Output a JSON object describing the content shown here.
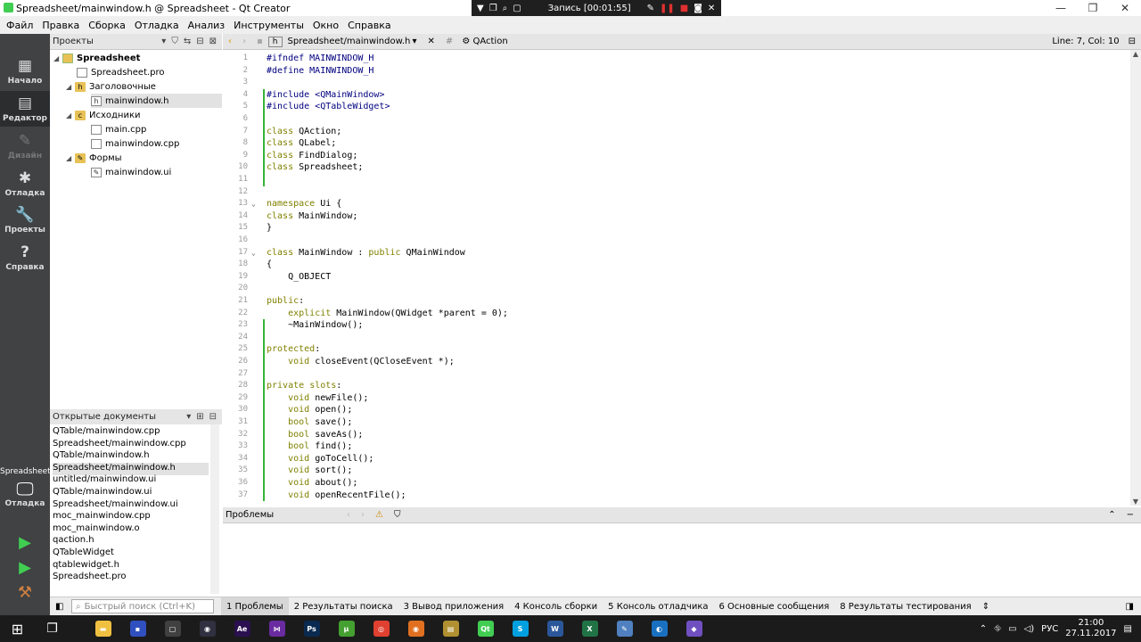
{
  "window": {
    "title": "Spreadsheet/mainwindow.h @ Spreadsheet - Qt Creator",
    "controls": [
      "—",
      "❐",
      "✕"
    ]
  },
  "recording": {
    "label": "Запись [00:01:55]"
  },
  "menu": [
    "Файл",
    "Правка",
    "Сборка",
    "Отладка",
    "Анализ",
    "Инструменты",
    "Окно",
    "Справка"
  ],
  "modes": [
    {
      "label": "Начало",
      "icon": "▦"
    },
    {
      "label": "Редактор",
      "icon": "▤"
    },
    {
      "label": "Дизайн",
      "icon": "✎"
    },
    {
      "label": "Отладка",
      "icon": "✱"
    },
    {
      "label": "Проекты",
      "icon": "🔧"
    },
    {
      "label": "Справка",
      "icon": "?"
    }
  ],
  "kit": {
    "project": "Spreadsheet",
    "config": "Отладка"
  },
  "projects": {
    "header": "Проекты",
    "tree": [
      {
        "label": "Spreadsheet",
        "level": 0,
        "kind": "proj",
        "arrow": "◢",
        "bold": true
      },
      {
        "label": "Spreadsheet.pro",
        "level": 1,
        "kind": "file",
        "arrow": ""
      },
      {
        "label": "Заголовочные",
        "level": 1,
        "kind": "folder",
        "arrow": "◢"
      },
      {
        "label": "mainwindow.h",
        "level": 2,
        "kind": "file",
        "arrow": "",
        "selected": true
      },
      {
        "label": "Исходники",
        "level": 1,
        "kind": "folder",
        "arrow": "◢"
      },
      {
        "label": "main.cpp",
        "level": 2,
        "kind": "file",
        "arrow": ""
      },
      {
        "label": "mainwindow.cpp",
        "level": 2,
        "kind": "file",
        "arrow": ""
      },
      {
        "label": "Формы",
        "level": 1,
        "kind": "folder",
        "arrow": "◢"
      },
      {
        "label": "mainwindow.ui",
        "level": 2,
        "kind": "file",
        "arrow": ""
      }
    ]
  },
  "open_documents": {
    "header": "Открытые документы",
    "items": [
      "QTable/mainwindow.cpp",
      "Spreadsheet/mainwindow.cpp",
      "QTable/mainwindow.h",
      "Spreadsheet/mainwindow.h",
      "untitled/mainwindow.ui",
      "QTable/mainwindow.ui",
      "Spreadsheet/mainwindow.ui",
      "moc_mainwindow.cpp",
      "moc_mainwindow.o",
      "qaction.h",
      "QTableWidget",
      "qtablewidget.h",
      "Spreadsheet.pro"
    ],
    "selected_index": 3
  },
  "editor": {
    "file_tab": "Spreadsheet/mainwindow.h",
    "symbol": "QAction",
    "cursor": "Line: 7, Col: 10",
    "lines": [
      {
        "n": "1",
        "t": "#ifndef MAINWINDOW_H"
      },
      {
        "n": "2",
        "t": "#define MAINWINDOW_H"
      },
      {
        "n": "3",
        "t": ""
      },
      {
        "n": "4",
        "t": "#include <QMainWindow>"
      },
      {
        "n": "5",
        "t": "#include <QTableWidget>"
      },
      {
        "n": "6",
        "t": ""
      },
      {
        "n": "7",
        "t": "class QAction;"
      },
      {
        "n": "8",
        "t": "class QLabel;"
      },
      {
        "n": "9",
        "t": "class FindDialog;"
      },
      {
        "n": "10",
        "t": "class Spreadsheet;"
      },
      {
        "n": "11",
        "t": ""
      },
      {
        "n": "12",
        "t": ""
      },
      {
        "n": "13",
        "t": "namespace Ui {"
      },
      {
        "n": "14",
        "t": "class MainWindow;"
      },
      {
        "n": "15",
        "t": "}"
      },
      {
        "n": "16",
        "t": ""
      },
      {
        "n": "17",
        "t": "class MainWindow : public QMainWindow"
      },
      {
        "n": "18",
        "t": "{"
      },
      {
        "n": "19",
        "t": "    Q_OBJECT"
      },
      {
        "n": "20",
        "t": ""
      },
      {
        "n": "21",
        "t": "public:"
      },
      {
        "n": "22",
        "t": "    explicit MainWindow(QWidget *parent = 0);"
      },
      {
        "n": "23",
        "t": "    ~MainWindow();"
      },
      {
        "n": "24",
        "t": ""
      },
      {
        "n": "25",
        "t": "protected:"
      },
      {
        "n": "26",
        "t": "    void closeEvent(QCloseEvent *);"
      },
      {
        "n": "27",
        "t": ""
      },
      {
        "n": "28",
        "t": "private slots:"
      },
      {
        "n": "29",
        "t": "    void newFile();"
      },
      {
        "n": "30",
        "t": "    void open();"
      },
      {
        "n": "31",
        "t": "    bool save();"
      },
      {
        "n": "32",
        "t": "    bool saveAs();"
      },
      {
        "n": "33",
        "t": "    bool find();"
      },
      {
        "n": "34",
        "t": "    void goToCell();"
      },
      {
        "n": "35",
        "t": "    void sort();"
      },
      {
        "n": "36",
        "t": "    void about();"
      },
      {
        "n": "37",
        "t": "    void openRecentFile();"
      }
    ]
  },
  "problems": {
    "header": "Проблемы"
  },
  "locator": {
    "placeholder": "Быстрый поиск (Ctrl+K)"
  },
  "output_tabs": [
    "1  Проблемы",
    "2  Результаты поиска",
    "3  Вывод приложения",
    "4  Консоль сборки",
    "5  Консоль отладчика",
    "6  Основные сообщения",
    "8  Результаты тестирования"
  ],
  "taskbar": {
    "apps": [
      {
        "name": "explorer",
        "color": "#f0c040",
        "glyph": "▬"
      },
      {
        "name": "save",
        "color": "#3050c0",
        "glyph": "▪"
      },
      {
        "name": "store",
        "color": "#404040",
        "glyph": "▢"
      },
      {
        "name": "obs",
        "color": "#303040",
        "glyph": "◉"
      },
      {
        "name": "after-effects",
        "color": "#2a1050",
        "glyph": "Ae"
      },
      {
        "name": "visual-studio",
        "color": "#6a2ba0",
        "glyph": "⋈"
      },
      {
        "name": "photoshop",
        "color": "#0a2a50",
        "glyph": "Ps"
      },
      {
        "name": "utorrent",
        "color": "#44a030",
        "glyph": "µ"
      },
      {
        "name": "chrome",
        "color": "#e04030",
        "glyph": "◎"
      },
      {
        "name": "firefox",
        "color": "#e07020",
        "glyph": "◉"
      },
      {
        "name": "notepad",
        "color": "#b09030",
        "glyph": "▤"
      },
      {
        "name": "qt-creator",
        "color": "#41cd52",
        "glyph": "Qt"
      },
      {
        "name": "skype",
        "color": "#00a0e0",
        "glyph": "S"
      },
      {
        "name": "word",
        "color": "#2b579a",
        "glyph": "W"
      },
      {
        "name": "excel",
        "color": "#217346",
        "glyph": "X"
      },
      {
        "name": "editor",
        "color": "#5080c0",
        "glyph": "✎"
      },
      {
        "name": "browser",
        "color": "#1a70c0",
        "glyph": "◐"
      },
      {
        "name": "vs-code",
        "color": "#7050c0",
        "glyph": "◆"
      }
    ],
    "lang": "РУС",
    "time": "21:00",
    "date": "27.11.2017"
  }
}
